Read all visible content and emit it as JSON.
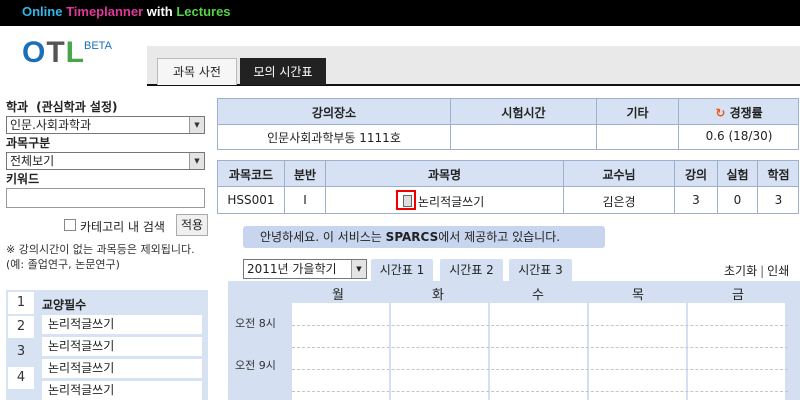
{
  "banner": {
    "part1": "Online ",
    "part2": "Timeplanner",
    "part3": " with ",
    "part4": "Lectures"
  },
  "logo": {
    "o": "O",
    "t": "T",
    "l": "L",
    "beta": "BETA"
  },
  "nav_tabs": [
    {
      "label": "과목 사전"
    },
    {
      "label": "모의 시간표"
    }
  ],
  "left": {
    "dept_label": "학과",
    "dept_setting": "(관심학과 설정)",
    "dept_value": "인문.사회과학과",
    "type_label": "과목구분",
    "type_value": "전체보기",
    "keyword_label": "키워드",
    "keyword_value": "",
    "category_search_label": "카테고리 내 검색",
    "apply_label": "적용",
    "note": "※ 강의시간이 없는 과목등은 제외됩니다. (예: 졸업연구, 논문연구)"
  },
  "category_panel": {
    "numbers": [
      "1",
      "2",
      "3",
      "4"
    ],
    "title": "교양필수",
    "items": [
      "논리적글쓰기",
      "논리적글쓰기",
      "논리적글쓰기",
      "논리적글쓰기"
    ]
  },
  "info_table": {
    "headers": {
      "room": "강의장소",
      "exam": "시험시간",
      "etc": "기타",
      "competition": "경쟁률"
    },
    "values": {
      "room": "인문사회과학부동 1111호",
      "exam": "",
      "etc": "",
      "competition": "0.6 (18/30)"
    }
  },
  "course_table": {
    "headers": {
      "code": "과목코드",
      "section": "분반",
      "name": "과목명",
      "professor": "교수님",
      "lecture": "강의",
      "lab": "실험",
      "credit": "학점"
    },
    "row": {
      "code": "HSS001",
      "section": "I",
      "name": "논리적글쓰기",
      "professor": "김은경",
      "lecture": "3",
      "lab": "0",
      "credit": "3"
    }
  },
  "notice": {
    "pre": "안녕하세요. 이 서비스는 ",
    "brand": "SPARCS",
    "post": "에서 제공하고 있습니다."
  },
  "schedule": {
    "semester": "2011년 가을학기",
    "tabs": [
      "시간표 1",
      "시간표 2",
      "시간표 3"
    ],
    "reset_label": "초기화",
    "print_label": "인쇄",
    "days": [
      "월",
      "화",
      "수",
      "목",
      "금"
    ],
    "times": [
      "오전 8시",
      "오전 9시"
    ]
  },
  "colors": {
    "header_bg": "#d6e2f3",
    "border": "#9db0cc",
    "highlight": "#e00000"
  },
  "icons": {
    "refresh": "refresh-icon",
    "document": "document-icon"
  }
}
